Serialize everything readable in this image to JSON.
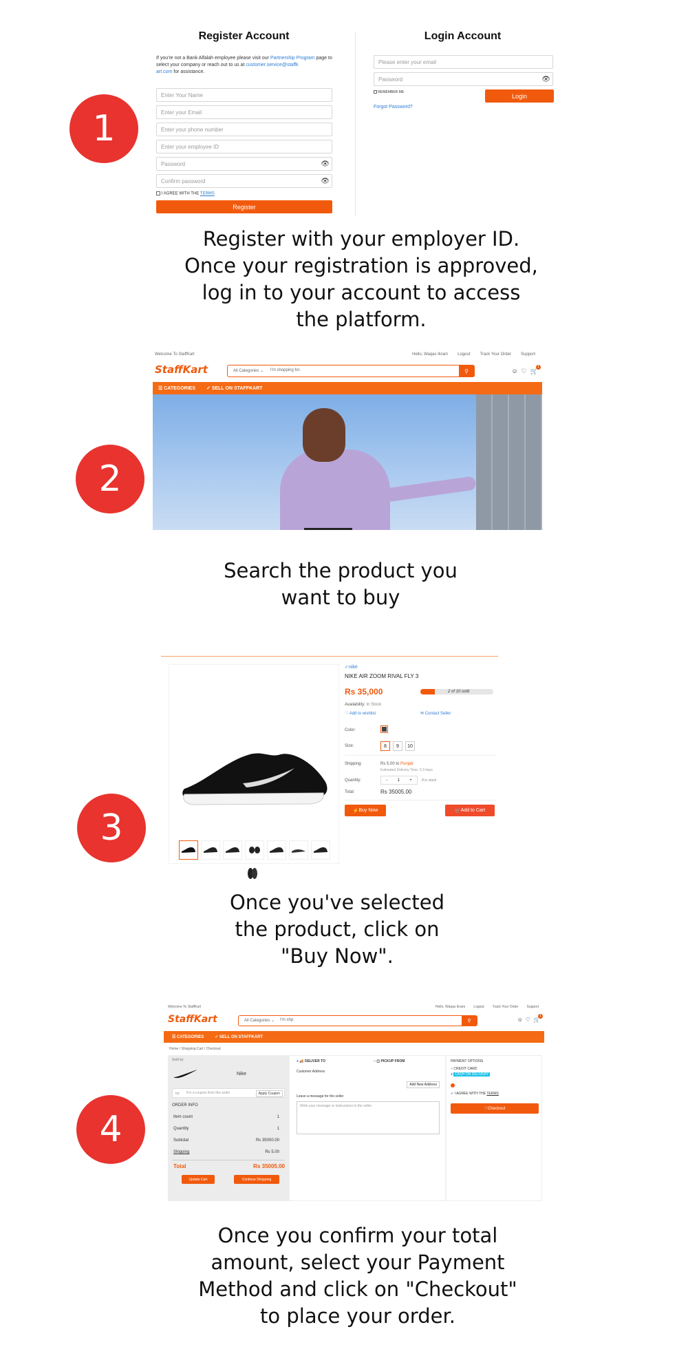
{
  "steps": [
    {
      "number": "1",
      "caption": [
        "Register with your employer ID.",
        "Once your registration is approved,",
        "log in to your account to access",
        "the platform."
      ]
    },
    {
      "number": "2",
      "caption": [
        "Search the product you",
        "want to buy"
      ]
    },
    {
      "number": "3",
      "caption": [
        "Once you've selected",
        "the product, click on",
        "\"Buy Now\"."
      ]
    },
    {
      "number": "4",
      "caption": [
        "Once you confirm your total",
        "amount, select your Payment",
        "Method and click on \"Checkout\"",
        "to place your order."
      ]
    }
  ],
  "register": {
    "title": "Register Account",
    "intro_1": "If you're not a Bank Alfalah employee please visit our",
    "partner_link": "Partnership Program",
    "intro_2": "page to select your company or reach out to us at",
    "email_link_1": "customer.service@staffk",
    "email_link_2": "art.com",
    "intro_3": "for assistance.",
    "name_placeholder": "Enter Your Name",
    "email_placeholder": "Enter your Email",
    "phone_placeholder": "Enter your phone number",
    "employee_placeholder": "Enter your employee ID",
    "password_placeholder": "Password",
    "confirm_placeholder": "Confirm password",
    "agree_text": "I AGREE WITH THE",
    "terms": "TERMS",
    "button": "Register"
  },
  "login": {
    "title": "Login Account",
    "email_placeholder": "Please enter your email",
    "password_placeholder": "Password",
    "remember": "REMEMBER ME",
    "button": "Login",
    "forgot": "Forgot Password?"
  },
  "shop": {
    "welcome": "Welcome To StaffKart",
    "hello": "Hello, Waqas Ikram",
    "logout": "Logout",
    "track": "Track Your Order",
    "support": "Support",
    "logo_a": "Staff",
    "logo_b": "Kart",
    "category_select": "All Categories",
    "search_placeholder": "I'm shopping for.",
    "search_value_4": "I'm shp",
    "cart_count": "1",
    "nav_categories": "CATEGORIES",
    "nav_sell": "SELL ON STAFFKART"
  },
  "product": {
    "brand": "nike",
    "name": "NIKE AIR ZOOM RIVAL FLY 3",
    "price": "Rs 35,000",
    "sold": "2 of 10 sold",
    "sold_fraction": 0.2,
    "availability_label": "Availability:",
    "availability": "In Stock",
    "wishlist": "Add to wishlist",
    "contact": "Contact Seller",
    "color_label": "Color:",
    "size_label": "Size:",
    "sizes": [
      "8",
      "9",
      "10"
    ],
    "shipping_label": "Shipping:",
    "shipping_value": "Rs 5.00 to",
    "shipping_region": "Punjab",
    "delivery": "Estimated Delivery Time: 2-3 days",
    "quantity_label": "Quantity:",
    "quantity": "1",
    "in_stock": "8 in stock",
    "total_label": "Total:",
    "total": "Rs 35005.00",
    "buy_now": "Buy Now",
    "add_to_cart": "Add to Cart"
  },
  "checkout": {
    "breadcrumb": [
      "Home",
      "Shopping Cart",
      "Checkout"
    ],
    "sold_by": "Sold by",
    "seller": "Nike",
    "coupon_placeholder": "For a coupon from this seller",
    "apply_coupon": "Apply Coupon",
    "order_info": "ORDER INFO",
    "rows": [
      {
        "label": "Item count",
        "value": "1"
      },
      {
        "label": "Quantity",
        "value": "1"
      },
      {
        "label": "Subtotal",
        "value": "Rs 35000.00"
      },
      {
        "label": "Shipping",
        "value": "Rs 5.00"
      }
    ],
    "total_label": "Total",
    "total_value": "Rs 35005.00",
    "update_cart": "Update Cart",
    "continue": "Continue Shopping",
    "deliver_to": "DELIVER TO",
    "pickup_from": "PICKUP FROM",
    "customer_address": "Customer Address",
    "add_address": "Add New Address",
    "message_label": "Leave a message for the seller",
    "message_placeholder": "Write your message or instructions to the seller",
    "payment_options": "PAYMENT OPTIONS",
    "credit_card": "CREDIT CARD",
    "cod": "CASH ON DELIVERY",
    "agree_text": "I AGREE WITH THE",
    "terms": "TERMS",
    "checkout": "Checkout"
  },
  "colors": {
    "accent": "#f15a0d",
    "step_circle": "#e8332f",
    "cod_highlight": "#19c3e8"
  }
}
